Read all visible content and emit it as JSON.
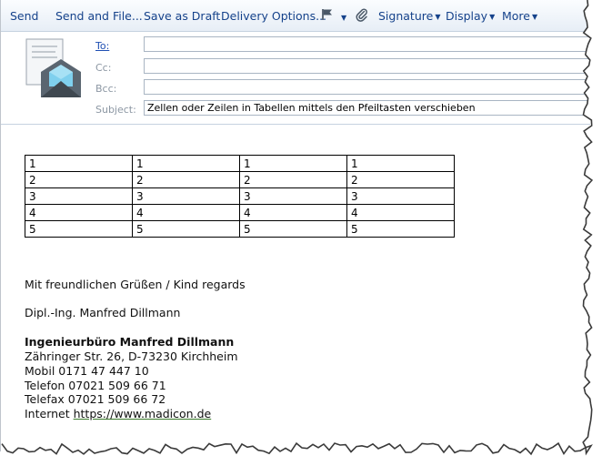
{
  "toolbar": {
    "send": "Send",
    "send_and_file": "Send and File...",
    "save_as_draft": "Save as Draft",
    "delivery_options": "Delivery Options...",
    "signature": "Signature",
    "display": "Display",
    "more": "More"
  },
  "header": {
    "to_label": "To:",
    "cc_label": "Cc:",
    "bcc_label": "Bcc:",
    "subject_label": "Subject:",
    "to_value": "",
    "cc_value": "",
    "bcc_value": "",
    "subject_value": "Zellen oder Zeilen in Tabellen mittels den Pfeiltasten verschieben"
  },
  "body": {
    "table": [
      [
        "1",
        "1",
        "1",
        "1"
      ],
      [
        "2",
        "2",
        "2",
        "2"
      ],
      [
        "3",
        "3",
        "3",
        "3"
      ],
      [
        "4",
        "4",
        "4",
        "4"
      ],
      [
        "5",
        "5",
        "5",
        "5"
      ]
    ],
    "greeting": "Mit freundlichen Grüßen / Kind regards",
    "sender_name": "Dipl.-Ing. Manfred Dillmann",
    "company": "Ingenieurbüro Manfred Dillmann",
    "address": "Zähringer Str. 26, D-73230 Kirchheim",
    "mobile": "Mobil 0171 47 447 10",
    "phone": "Telefon 07021 509 66 71",
    "fax": "Telefax 07021 509 66 72",
    "internet_label": "Internet ",
    "internet_url": "https://www.madicon.de"
  },
  "icons": {
    "flag": "flag-icon",
    "attach": "paperclip-icon",
    "envelope": "envelope-icon"
  }
}
